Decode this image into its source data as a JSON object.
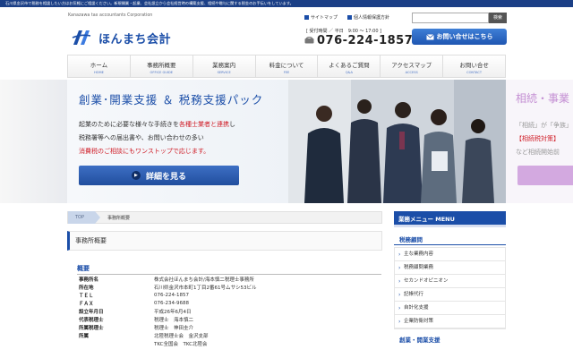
{
  "topbar": {
    "text": "石川県金沢市で税務を相談したい方はお気軽にご相談ください。新規開業・起業、会社設立から会社経営時の構築支援、相続や贈与に関する税金のお手伝いをしています。"
  },
  "logo": {
    "subtitle": "Kanazawa tax accountants Corporation",
    "name": "ほんまち会計"
  },
  "utility": {
    "sitemap": "サイトマップ",
    "privacy": "個人情報保護方針"
  },
  "search": {
    "placeholder": "",
    "button": "検索"
  },
  "contact": {
    "hours": "[ 受付時間 ／ 平日　9:00 ～ 17:00 ]",
    "phone": "076-224-1857",
    "button": "お問い合せはこちら"
  },
  "nav": [
    {
      "label": "ホーム",
      "en": "HOME"
    },
    {
      "label": "事務所概要",
      "en": "OFFICE GUIDE"
    },
    {
      "label": "業務案内",
      "en": "SERVICE"
    },
    {
      "label": "料金について",
      "en": "FEE"
    },
    {
      "label": "よくあるご質問",
      "en": "Q&A"
    },
    {
      "label": "アクセスマップ",
      "en": "ACCESS"
    },
    {
      "label": "お問い合せ",
      "en": "CONTACT"
    }
  ],
  "hero": {
    "title": "創業･開業支援 ＆ 税務支援パック",
    "line1_a": "起業のために必要な様々な手続きを",
    "line1_red": "各種士業者と連携",
    "line1_b": "し",
    "line2": "税務署等への届出書や、お問い合わせの多い",
    "line3_red": "消費税のご相談にもワンストップで応じます。",
    "button": "詳細を見る",
    "peek_title": "相続・事業",
    "peek_line1": "「相続」が「争族」",
    "peek_line2_red": "【相続税対策】",
    "peek_line3": "など相続開始前"
  },
  "breadcrumb": {
    "home": "TOP",
    "current": "事務所概要"
  },
  "page": {
    "title": "事務所概要"
  },
  "overview": {
    "heading": "概要",
    "rows": [
      {
        "k": "事務所名",
        "v": "株式会社ほんまち会計/海本慎二税理士事務所"
      },
      {
        "k": "所在地",
        "v": "石川県金沢市本町1丁目2番61号ムサシ53ビル"
      },
      {
        "k": "ＴＥＬ",
        "v": "076-224-1857"
      },
      {
        "k": "ＦＡＸ",
        "v": "076-234-9688"
      },
      {
        "k": "設立年月日",
        "v": "平成26年6月4日"
      },
      {
        "k": "代表税理士",
        "v": "税理士　海本慎二"
      },
      {
        "k": "所属税理士",
        "v": "税理士　神田圭介"
      },
      {
        "k": "所属",
        "v": "北陸税理士会　金沢支部"
      },
      {
        "k": "",
        "v": "TKC全国会　TKC北陸会"
      }
    ]
  },
  "sidebar": {
    "heading": "業務メニュー MENU",
    "sub": "税務顧問",
    "items": [
      "主な業務内容",
      "税務顧問業務",
      "セカンドオピニオン",
      "記帳代行",
      "自計化支援",
      "企業防衛対策"
    ],
    "sub2": "創業・開業支援"
  }
}
